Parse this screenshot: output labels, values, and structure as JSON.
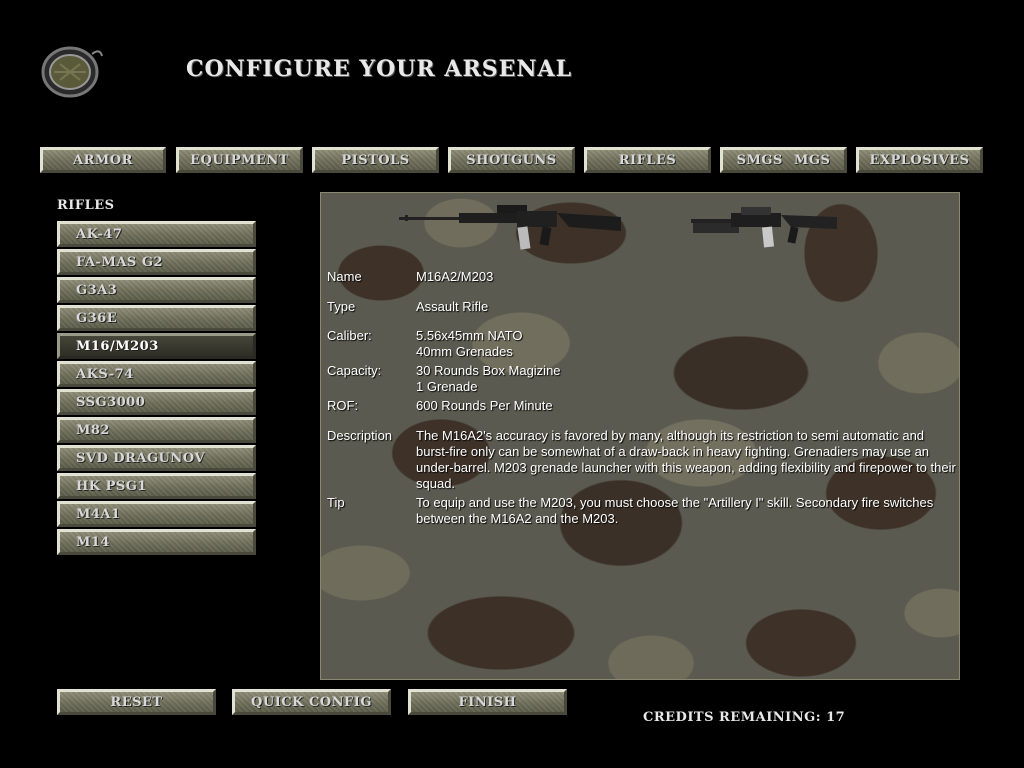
{
  "header": {
    "logo_text": "FA2",
    "title": "CONFIGURE YOUR ARSENAL"
  },
  "tabs": [
    {
      "label": "ARMOR"
    },
    {
      "label": "EQUIPMENT"
    },
    {
      "label": "PISTOLS"
    },
    {
      "label": "SHOTGUNS"
    },
    {
      "label": "RIFLES"
    },
    {
      "label": "SMGS MGS"
    },
    {
      "label": "EXPLOSIVES"
    }
  ],
  "weapon_list": {
    "header": "RIFLES",
    "selected": "M16/M203",
    "items": [
      {
        "label": "AK-47"
      },
      {
        "label": "FA-MAS G2"
      },
      {
        "label": "G3A3"
      },
      {
        "label": "G36E"
      },
      {
        "label": "M16/M203"
      },
      {
        "label": "AKS-74"
      },
      {
        "label": "SSG3000"
      },
      {
        "label": "M82"
      },
      {
        "label": "SVD DRAGUNOV"
      },
      {
        "label": "HK PSG1"
      },
      {
        "label": "M4A1"
      },
      {
        "label": "M14"
      }
    ]
  },
  "details": {
    "name": {
      "label": "Name",
      "value": "M16A2/M203"
    },
    "type": {
      "label": "Type",
      "value": "Assault Rifle"
    },
    "caliber": {
      "label": "Caliber:",
      "value": "5.56x45mm NATO\n40mm Grenades"
    },
    "capacity": {
      "label": "Capacity:",
      "value": "30 Rounds Box Magizine\n1 Grenade"
    },
    "rof": {
      "label": "ROF:",
      "value": "600 Rounds Per Minute"
    },
    "description": {
      "label": "Description",
      "value": "The M16A2's accuracy is favored by many, although its restriction to semi automatic and burst-fire only can be somewhat of a draw-back in heavy fighting. Grenadiers may use an under-barrel. M203 grenade launcher with this weapon, adding flexibility and firepower to their squad."
    },
    "tip": {
      "label": "Tip",
      "value": "To equip and use the M203, you must choose the \"Artillery I\" skill. Secondary fire switches between the M16A2 and the M203."
    }
  },
  "footer": {
    "reset_label": "RESET",
    "quick_config_label": "QUICK CONFIG",
    "finish_label": "FINISH",
    "credits_label": "CREDITS REMAINING:",
    "credits_value": "17"
  },
  "icons": {
    "logo": "game-logo-icon",
    "rifle_side": "rifle-icon",
    "rifle_angled": "rifle-grenade-launcher-icon"
  },
  "colors": {
    "button_face": "#777763",
    "button_highlight": "#e2e2d2",
    "selected_face": "#3a3a30",
    "camo_dark": "#3d3128",
    "camo_light": "#716d5d"
  }
}
